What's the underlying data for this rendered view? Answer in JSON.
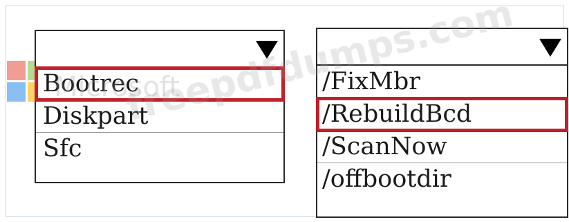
{
  "dropdown_left": {
    "selected": "",
    "options": [
      "Bootrec",
      "Diskpart",
      "Sfc"
    ],
    "highlighted_option": "Bootrec"
  },
  "dropdown_right": {
    "selected": "",
    "options": [
      "/FixMbr",
      "/RebuildBcd",
      "/ScanNow",
      "/offbootdir"
    ],
    "highlighted_option": "/RebuildBcd"
  },
  "watermark": {
    "brand": "Microsoft",
    "site": "freepdfdumps.com"
  },
  "colors": {
    "highlight_border": "#c0202a",
    "box_border": "#2a2a2a",
    "frame_border": "#c9d6e3"
  }
}
